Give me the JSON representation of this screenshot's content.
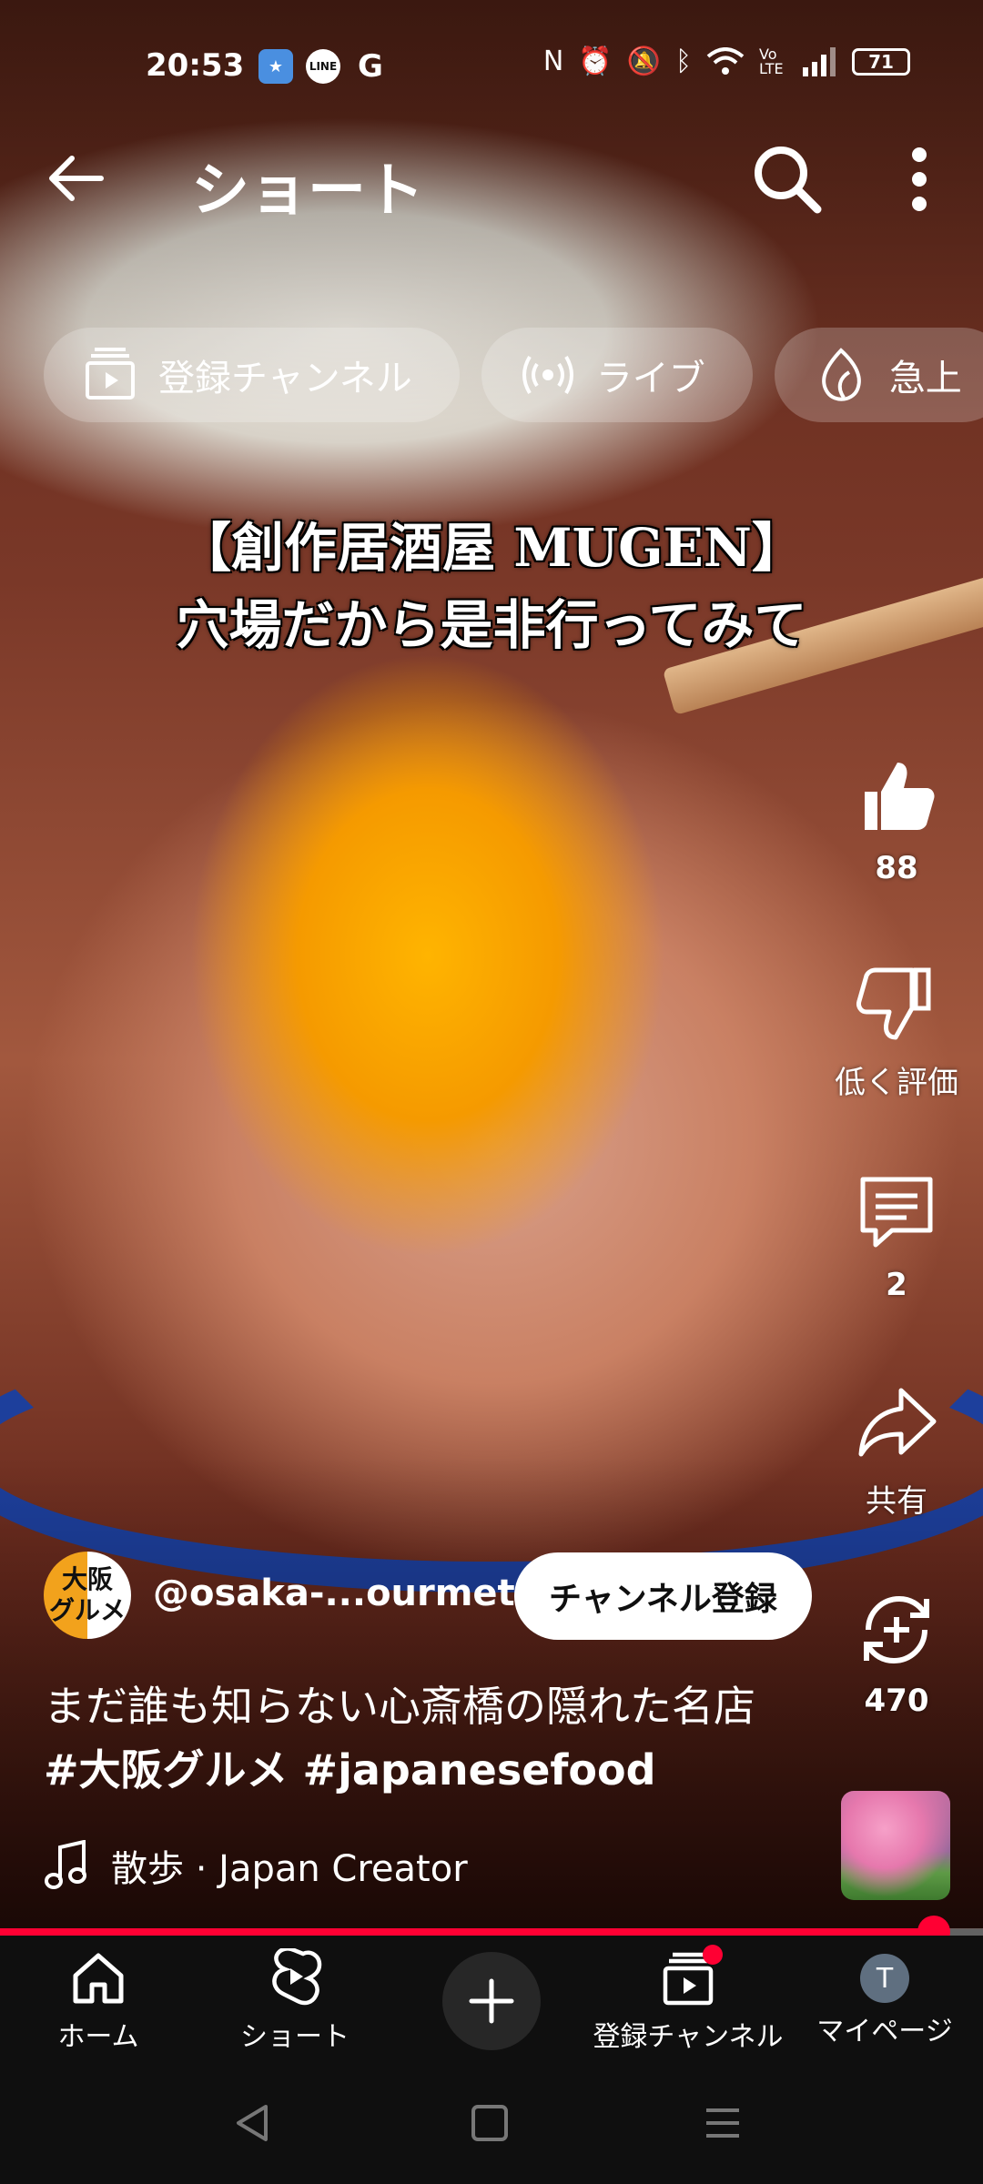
{
  "status_bar": {
    "time": "20:53",
    "notification_icons": [
      "app-icon",
      "line-icon",
      "google-icon"
    ],
    "line_label": "LINE",
    "google_label": "G",
    "volte_label": "Vo LTE",
    "battery": "71"
  },
  "header": {
    "title": "ショート"
  },
  "chips": [
    {
      "label": "登録チャンネル",
      "icon": "subscriptions-icon"
    },
    {
      "label": "ライブ",
      "icon": "live-icon"
    },
    {
      "label": "急上",
      "icon": "trending-icon"
    }
  ],
  "video": {
    "caption_line1": "【創作居酒屋 MUGEN】",
    "caption_line2": "穴場だから是非行ってみて"
  },
  "actions": {
    "like_count": "88",
    "dislike_label": "低く評価",
    "comment_count": "2",
    "share_label": "共有",
    "remix_count": "470"
  },
  "channel": {
    "avatar_line1": "大阪",
    "avatar_line2": "グルメ",
    "handle": "@osaka-...ourmet1",
    "subscribe_label": "チャンネル登録"
  },
  "description": {
    "text": "まだ誰も知らない心斎橋の隠れた名店",
    "hashtags": "#大阪グルメ #japanesefood"
  },
  "music": {
    "label": "散歩 · Japan Creator"
  },
  "playback": {
    "progress_fraction": 0.95
  },
  "bottom_nav": {
    "home": "ホーム",
    "shorts": "ショート",
    "subscriptions": "登録チャンネル",
    "mypage": "マイページ",
    "avatar_letter": "T"
  },
  "colors": {
    "accent": "#ff0033",
    "nav_bg": "#0f0f0f"
  }
}
